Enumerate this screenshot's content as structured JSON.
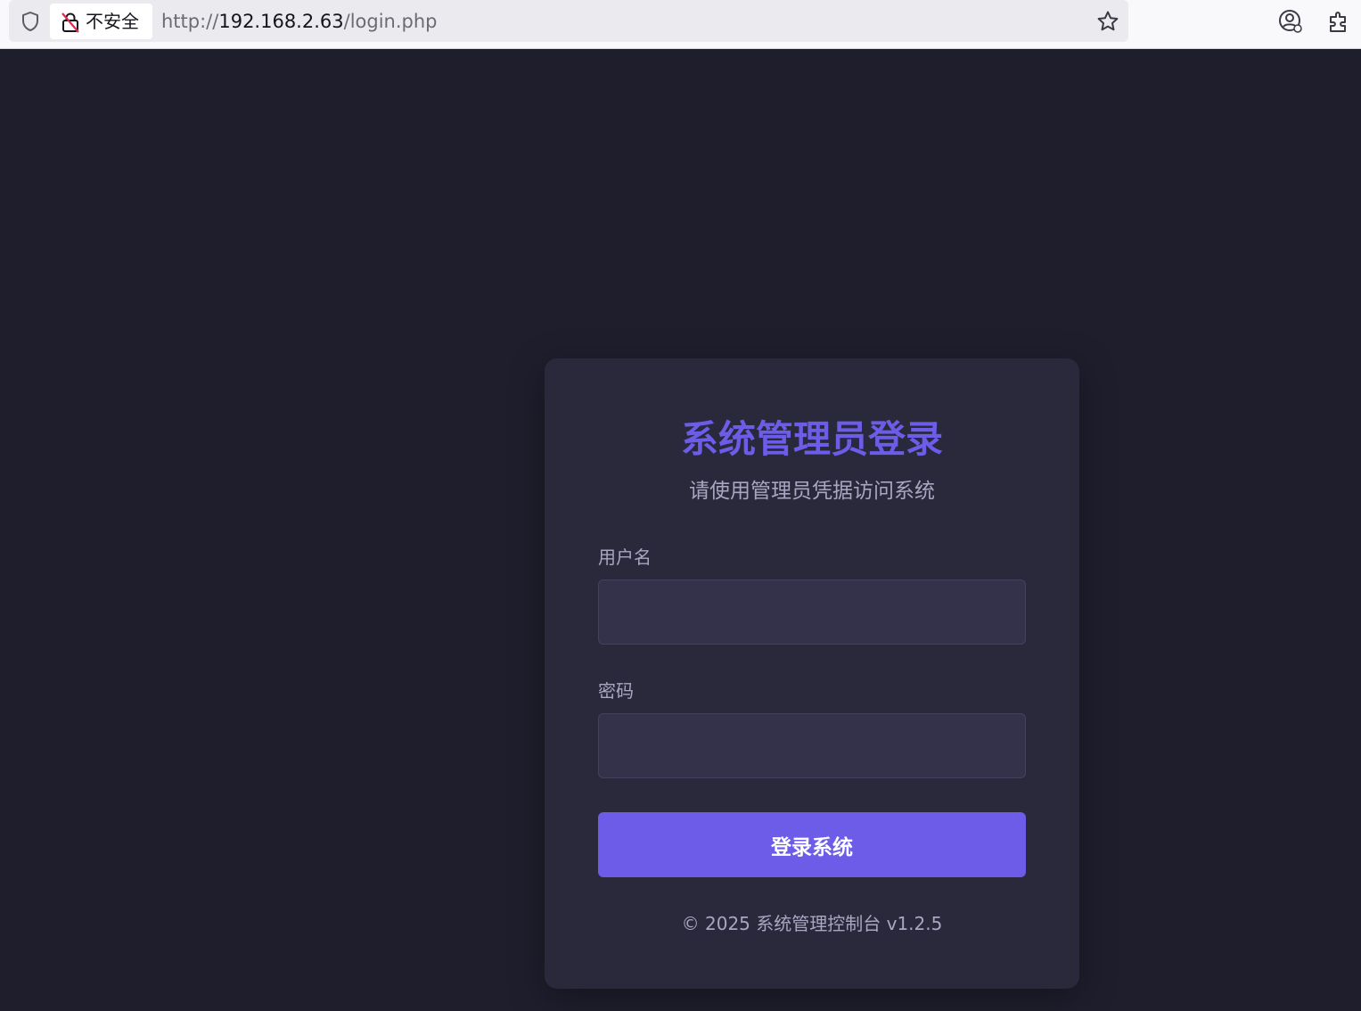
{
  "browser": {
    "security_label": "不安全",
    "url_scheme": "http://",
    "url_host": "192.168.2.63",
    "url_path": "/login.php"
  },
  "login": {
    "title": "系统管理员登录",
    "subtitle": "请使用管理员凭据访问系统",
    "username_label": "用户名",
    "username_value": "",
    "password_label": "密码",
    "password_value": "",
    "submit_label": "登录系统",
    "footer": "© 2025 系统管理控制台 v1.2.5"
  },
  "colors": {
    "page_bg": "#1f1e2d",
    "card_bg": "#2a293c",
    "accent": "#6c5ce7",
    "muted_text": "#a8a6c0",
    "input_bg": "#33324a"
  },
  "icons": [
    "shield-icon",
    "lock-insecure-icon",
    "star-icon",
    "account-icon",
    "extensions-icon"
  ]
}
